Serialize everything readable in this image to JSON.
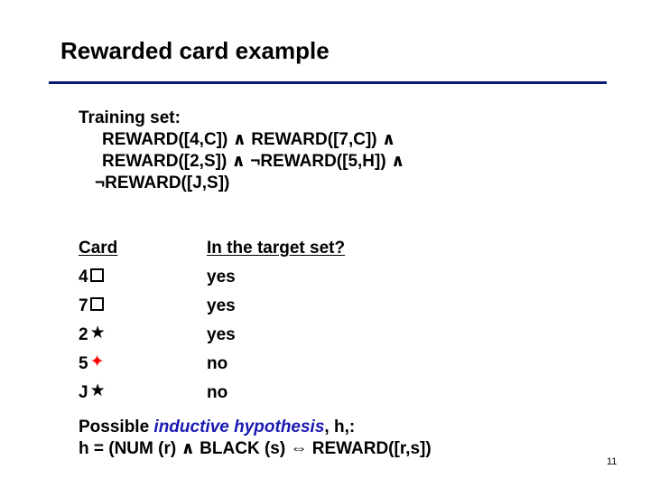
{
  "slide": {
    "title": "Rewarded card example",
    "rule_color": "#0d1a73",
    "page_number": "11"
  },
  "training": {
    "label": "Training set:",
    "lines": [
      "REWARD([4,C]) ∧ REWARD([7,C]) ∧",
      "REWARD([2,S]) ∧ ¬REWARD([5,H]) ∧",
      "¬REWARD([J,S])"
    ]
  },
  "table": {
    "headers": [
      "Card",
      "In the target set?"
    ],
    "rows": [
      {
        "rank": "4",
        "suit_icon": "clubs-box-icon",
        "suit_glyph": "",
        "suit_color": "#000000",
        "in_target": "yes"
      },
      {
        "rank": "7",
        "suit_icon": "clubs-box-icon",
        "suit_glyph": "",
        "suit_color": "#000000",
        "in_target": "yes"
      },
      {
        "rank": "2",
        "suit_icon": "spade-star-icon",
        "suit_glyph": "★",
        "suit_color": "#000000",
        "in_target": "yes"
      },
      {
        "rank": "5",
        "suit_icon": "heart-star-icon",
        "suit_glyph": "✦",
        "suit_color": "#ff0000",
        "in_target": "no"
      },
      {
        "rank": "J",
        "suit_icon": "spade-star-icon",
        "suit_glyph": "★",
        "suit_color": "#000000",
        "in_target": "no"
      }
    ]
  },
  "hypothesis": {
    "prefix": "Possible ",
    "emphasis": "inductive hypothesis",
    "emphasis_color": "#1a1ab3",
    "suffix": ", h,:",
    "formula": "h = (NUM (r) ∧ BLACK (s) ⇔ REWARD([r,s])"
  }
}
